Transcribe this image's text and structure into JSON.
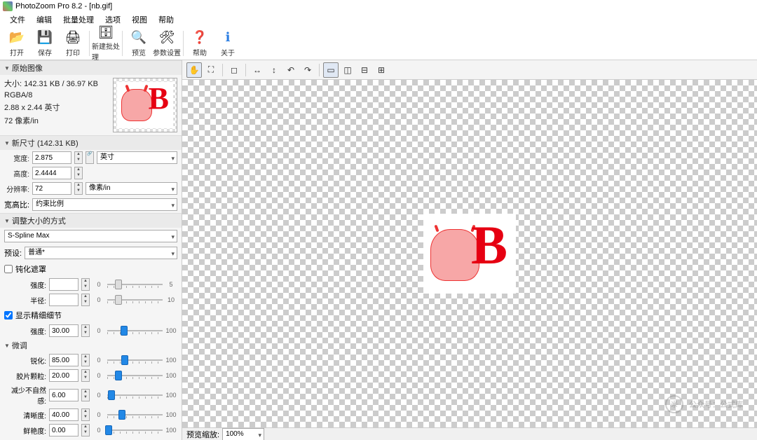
{
  "title": "PhotoZoom Pro 8.2 - [nb.gif]",
  "menu": [
    "文件",
    "编辑",
    "批量处理",
    "选项",
    "视图",
    "帮助"
  ],
  "toolbar": [
    {
      "label": "打开",
      "icon": "📂",
      "name": "open-button"
    },
    {
      "label": "保存",
      "icon": "💾",
      "name": "save-button"
    },
    {
      "label": "打印",
      "icon": "🖨",
      "name": "print-button"
    },
    {
      "sep": true
    },
    {
      "label": "新建批处理",
      "icon": "🗄",
      "name": "new-batch-button"
    },
    {
      "sep": true
    },
    {
      "label": "预览",
      "icon": "🔍",
      "name": "preview-button"
    },
    {
      "label": "参数设置",
      "icon": "🛠",
      "name": "settings-button"
    },
    {
      "sep": true
    },
    {
      "label": "帮助",
      "icon": "❓",
      "name": "help-button",
      "color": "#2a7de2"
    },
    {
      "label": "关于",
      "icon": "ℹ",
      "name": "about-button",
      "color": "#2a7de2"
    }
  ],
  "orig": {
    "header": "原始图像",
    "size": "大小: 142.31 KB / 36.97 KB",
    "mode": "RGBA/8",
    "dims": "2.88 x 2.44 英寸",
    "res": "72 像素/in"
  },
  "newsize": {
    "header": "新尺寸 (142.31 KB)",
    "width_lbl": "宽度:",
    "width_val": "2.875",
    "height_lbl": "高度:",
    "height_val": "2.4444",
    "unit": "英寸",
    "dpi_lbl": "分辨率:",
    "dpi_val": "72",
    "dpi_unit": "像素/in",
    "ratio_lbl": "宽高比:",
    "ratio_val": "约束比例"
  },
  "resize": {
    "header": "调整大小的方式",
    "method": "S-Spline Max",
    "preset_lbl": "预设:",
    "preset_val": "普通*"
  },
  "unsharp": {
    "label": "钝化遮罩",
    "checked": false,
    "strength_lbl": "强度:",
    "strength_val": "",
    "radius_lbl": "半径:",
    "radius_val": "",
    "min": "0",
    "max": "5",
    "rmax": "10"
  },
  "detail": {
    "label": "显示精细细节",
    "checked": true,
    "strength_lbl": "强度:",
    "strength_val": "30.00",
    "min": "0",
    "max": "100"
  },
  "finetune": {
    "header": "微调",
    "rows": [
      {
        "lbl": "锐化:",
        "val": "85.00",
        "pos": 32
      },
      {
        "lbl": "胶片颗粒:",
        "val": "20.00",
        "pos": 20
      },
      {
        "lbl": "减少不自然感:",
        "val": "6.00",
        "pos": 8
      },
      {
        "lbl": "清晰度:",
        "val": "40.00",
        "pos": 26
      },
      {
        "lbl": "鲜艳度:",
        "val": "0.00",
        "pos": 2
      }
    ],
    "min": "0",
    "max": "100"
  },
  "canvas_tools": [
    {
      "icon": "✋",
      "name": "pan-tool",
      "active": true
    },
    {
      "icon": "⛶",
      "name": "marquee-tool"
    },
    {
      "sep": true
    },
    {
      "icon": "◻",
      "name": "crop-tool"
    },
    {
      "sep": true
    },
    {
      "icon": "↔",
      "name": "flip-h-tool"
    },
    {
      "icon": "↕",
      "name": "flip-v-tool"
    },
    {
      "icon": "↶",
      "name": "rotate-ccw-tool"
    },
    {
      "icon": "↷",
      "name": "rotate-cw-tool"
    },
    {
      "sep": true
    },
    {
      "icon": "▭",
      "name": "view-single",
      "active": true
    },
    {
      "icon": "◫",
      "name": "view-split-v"
    },
    {
      "icon": "⊟",
      "name": "view-split-h"
    },
    {
      "icon": "⊞",
      "name": "view-quad"
    }
  ],
  "zoom": {
    "lbl": "预览缩放:",
    "val": "100%"
  },
  "watermark": "公众号：公式库"
}
